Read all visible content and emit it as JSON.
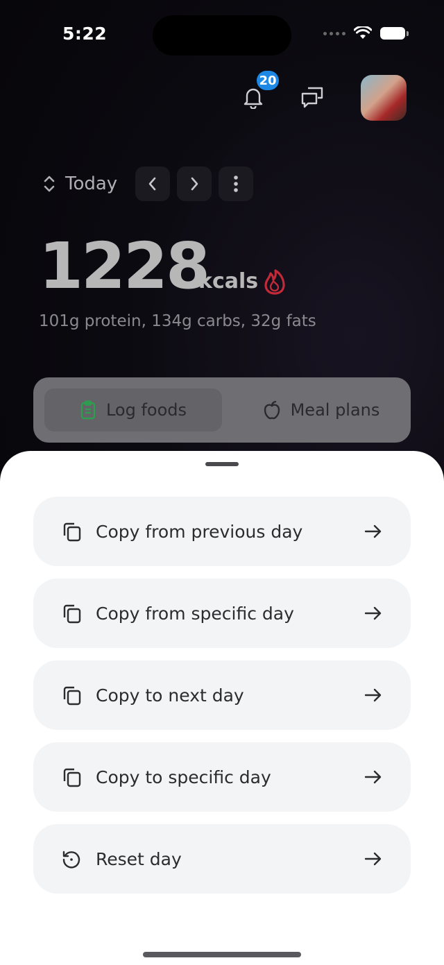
{
  "status_bar": {
    "time": "5:22"
  },
  "header": {
    "notification_count": "20",
    "icons": [
      "bell-icon",
      "chat-bubbles-icon"
    ]
  },
  "day_nav": {
    "label": "Today"
  },
  "summary": {
    "calories": "1228",
    "unit": "kcals",
    "macros": "101g protein, 134g carbs, 32g fats"
  },
  "tabs": [
    {
      "label": "Log foods",
      "icon": "clipboard-icon",
      "selected": true
    },
    {
      "label": "Meal plans",
      "icon": "apple-icon",
      "selected": false
    }
  ],
  "sheet": {
    "options": [
      {
        "label": "Copy from previous day",
        "icon": "copy-icon"
      },
      {
        "label": "Copy from specific day",
        "icon": "copy-icon"
      },
      {
        "label": "Copy to next day",
        "icon": "copy-icon"
      },
      {
        "label": "Copy to specific day",
        "icon": "copy-icon"
      },
      {
        "label": "Reset day",
        "icon": "reset-icon"
      }
    ]
  },
  "colors": {
    "badge": "#1e88e5",
    "flame": "#c22a3a",
    "clipboard": "#2e9d4f",
    "sheet_row": "#f3f4f6"
  }
}
